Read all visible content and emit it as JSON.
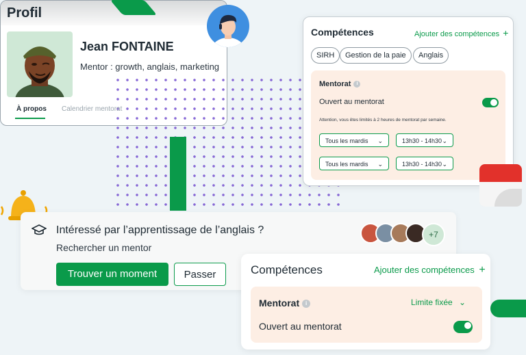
{
  "profile": {
    "title": "Profil",
    "name": "Jean FONTAINE",
    "role": "Mentor : growth, anglais, marketing",
    "tabs": [
      "À propos",
      "Calendrier mentorat"
    ]
  },
  "skills_card": {
    "title": "Compétences",
    "add_label": "Ajouter des compétences",
    "chips": [
      "SIRH",
      "Gestion de la paie",
      "Anglais"
    ],
    "mentorat": {
      "title": "Mentorat",
      "open_label": "Ouvert au mentorat",
      "warning": "Attention, vous êtes limités à 2 heures de mentorat par semaine.",
      "slots": [
        {
          "day": "Tous les mardis",
          "time": "13h30 - 14h30"
        },
        {
          "day": "Tous les mardis",
          "time": "13h30 - 14h30"
        }
      ]
    }
  },
  "learning": {
    "question": "Intéressé par l’apprentissage de l’anglais ?",
    "subtitle": "Rechercher un mentor",
    "primary_button": "Trouver un moment",
    "secondary_button": "Passer",
    "more_count": "+7"
  },
  "skills_card_2": {
    "title": "Compétences",
    "add_label": "Ajouter des compétences",
    "mentorat_title": "Mentorat",
    "limit_label": "Limite fixée",
    "open_label": "Ouvert au mentorat"
  },
  "colors": {
    "accent": "#0a9a4a",
    "peach": "#fdeee4",
    "dots": "#7a57d1"
  }
}
